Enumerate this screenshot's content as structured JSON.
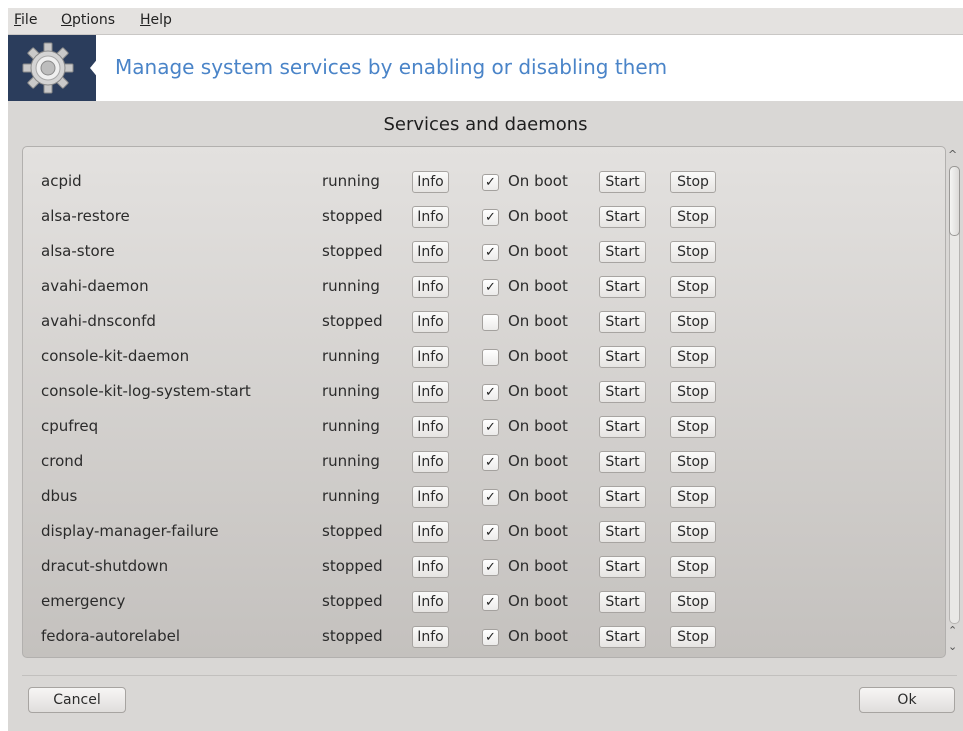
{
  "menubar": {
    "items": [
      {
        "label": "File",
        "accel": "F",
        "rest": "ile"
      },
      {
        "label": "Options",
        "accel": "O",
        "rest": "ptions"
      },
      {
        "label": "Help",
        "accel": "H",
        "rest": "elp"
      }
    ]
  },
  "banner": {
    "title": "Manage system services by enabling or disabling them",
    "icon": "gear-icon"
  },
  "section": {
    "title": "Services and daemons"
  },
  "services": [
    {
      "name": "acpid",
      "state": "running",
      "on_boot": true
    },
    {
      "name": "alsa-restore",
      "state": "stopped",
      "on_boot": true
    },
    {
      "name": "alsa-store",
      "state": "stopped",
      "on_boot": true
    },
    {
      "name": "avahi-daemon",
      "state": "running",
      "on_boot": true
    },
    {
      "name": "avahi-dnsconfd",
      "state": "stopped",
      "on_boot": false
    },
    {
      "name": "console-kit-daemon",
      "state": "running",
      "on_boot": false
    },
    {
      "name": "console-kit-log-system-start",
      "state": "running",
      "on_boot": true
    },
    {
      "name": "cpufreq",
      "state": "running",
      "on_boot": true
    },
    {
      "name": "crond",
      "state": "running",
      "on_boot": true
    },
    {
      "name": "dbus",
      "state": "running",
      "on_boot": true
    },
    {
      "name": "display-manager-failure",
      "state": "stopped",
      "on_boot": true
    },
    {
      "name": "dracut-shutdown",
      "state": "stopped",
      "on_boot": true
    },
    {
      "name": "emergency",
      "state": "stopped",
      "on_boot": true
    },
    {
      "name": "fedora-autorelabel",
      "state": "stopped",
      "on_boot": true
    }
  ],
  "row_labels": {
    "info": "Info",
    "on_boot": "On boot",
    "start": "Start",
    "stop": "Stop",
    "check_glyph": "✓"
  },
  "scrollbar": {
    "up_glyph": "^",
    "down_glyph": "⌃",
    "down_glyph2": "⌄"
  },
  "footer": {
    "cancel_label": "Cancel",
    "ok_label": "Ok"
  },
  "colors": {
    "banner_bg": "#2b3d5c",
    "banner_text": "#4a84c8",
    "window_bg": "#d9d7d5"
  }
}
